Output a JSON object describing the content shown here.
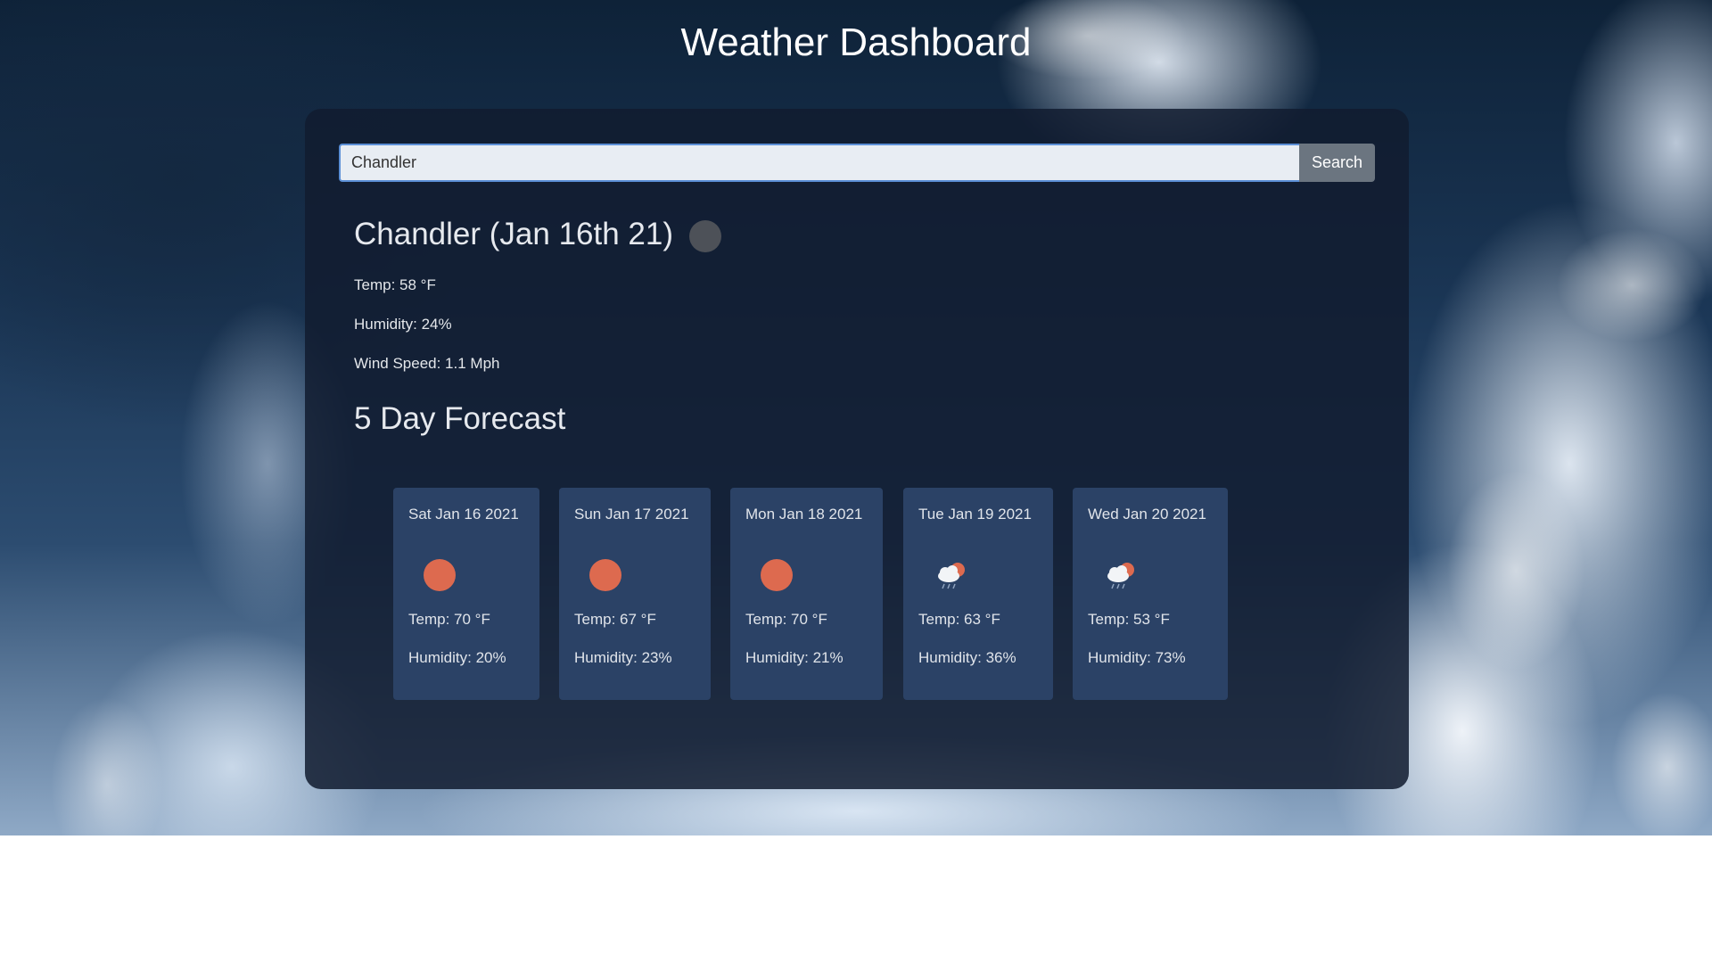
{
  "app": {
    "title": "Weather Dashboard"
  },
  "search": {
    "value": "Chandler",
    "button_label": "Search"
  },
  "current": {
    "heading": "Chandler (Jan 16th 21)",
    "icon": "weather-icon-placeholder",
    "temp": "Temp: 58 °F",
    "humidity": "Humidity: 24%",
    "wind": "Wind Speed: 1.1 Mph"
  },
  "forecast": {
    "heading": "5 Day Forecast",
    "days": [
      {
        "date": "Sat Jan 16 2021",
        "icon": "sun-icon",
        "temp": "Temp: 70 °F",
        "humidity": "Humidity: 20%"
      },
      {
        "date": "Sun Jan 17 2021",
        "icon": "sun-icon",
        "temp": "Temp: 67 °F",
        "humidity": "Humidity: 23%"
      },
      {
        "date": "Mon Jan 18 2021",
        "icon": "sun-icon",
        "temp": "Temp: 70 °F",
        "humidity": "Humidity: 21%"
      },
      {
        "date": "Tue Jan 19 2021",
        "icon": "rain-cloud-sun-icon",
        "temp": "Temp: 63 °F",
        "humidity": "Humidity: 36%"
      },
      {
        "date": "Wed Jan 20 2021",
        "icon": "rain-cloud-sun-icon",
        "temp": "Temp: 53 °F",
        "humidity": "Humidity: 73%"
      }
    ]
  },
  "colors": {
    "panel": "#121c30",
    "card": "#2b4266",
    "sun": "#dd6a4f",
    "search_button": "#6b7580",
    "input_border": "#5b8fd6"
  }
}
